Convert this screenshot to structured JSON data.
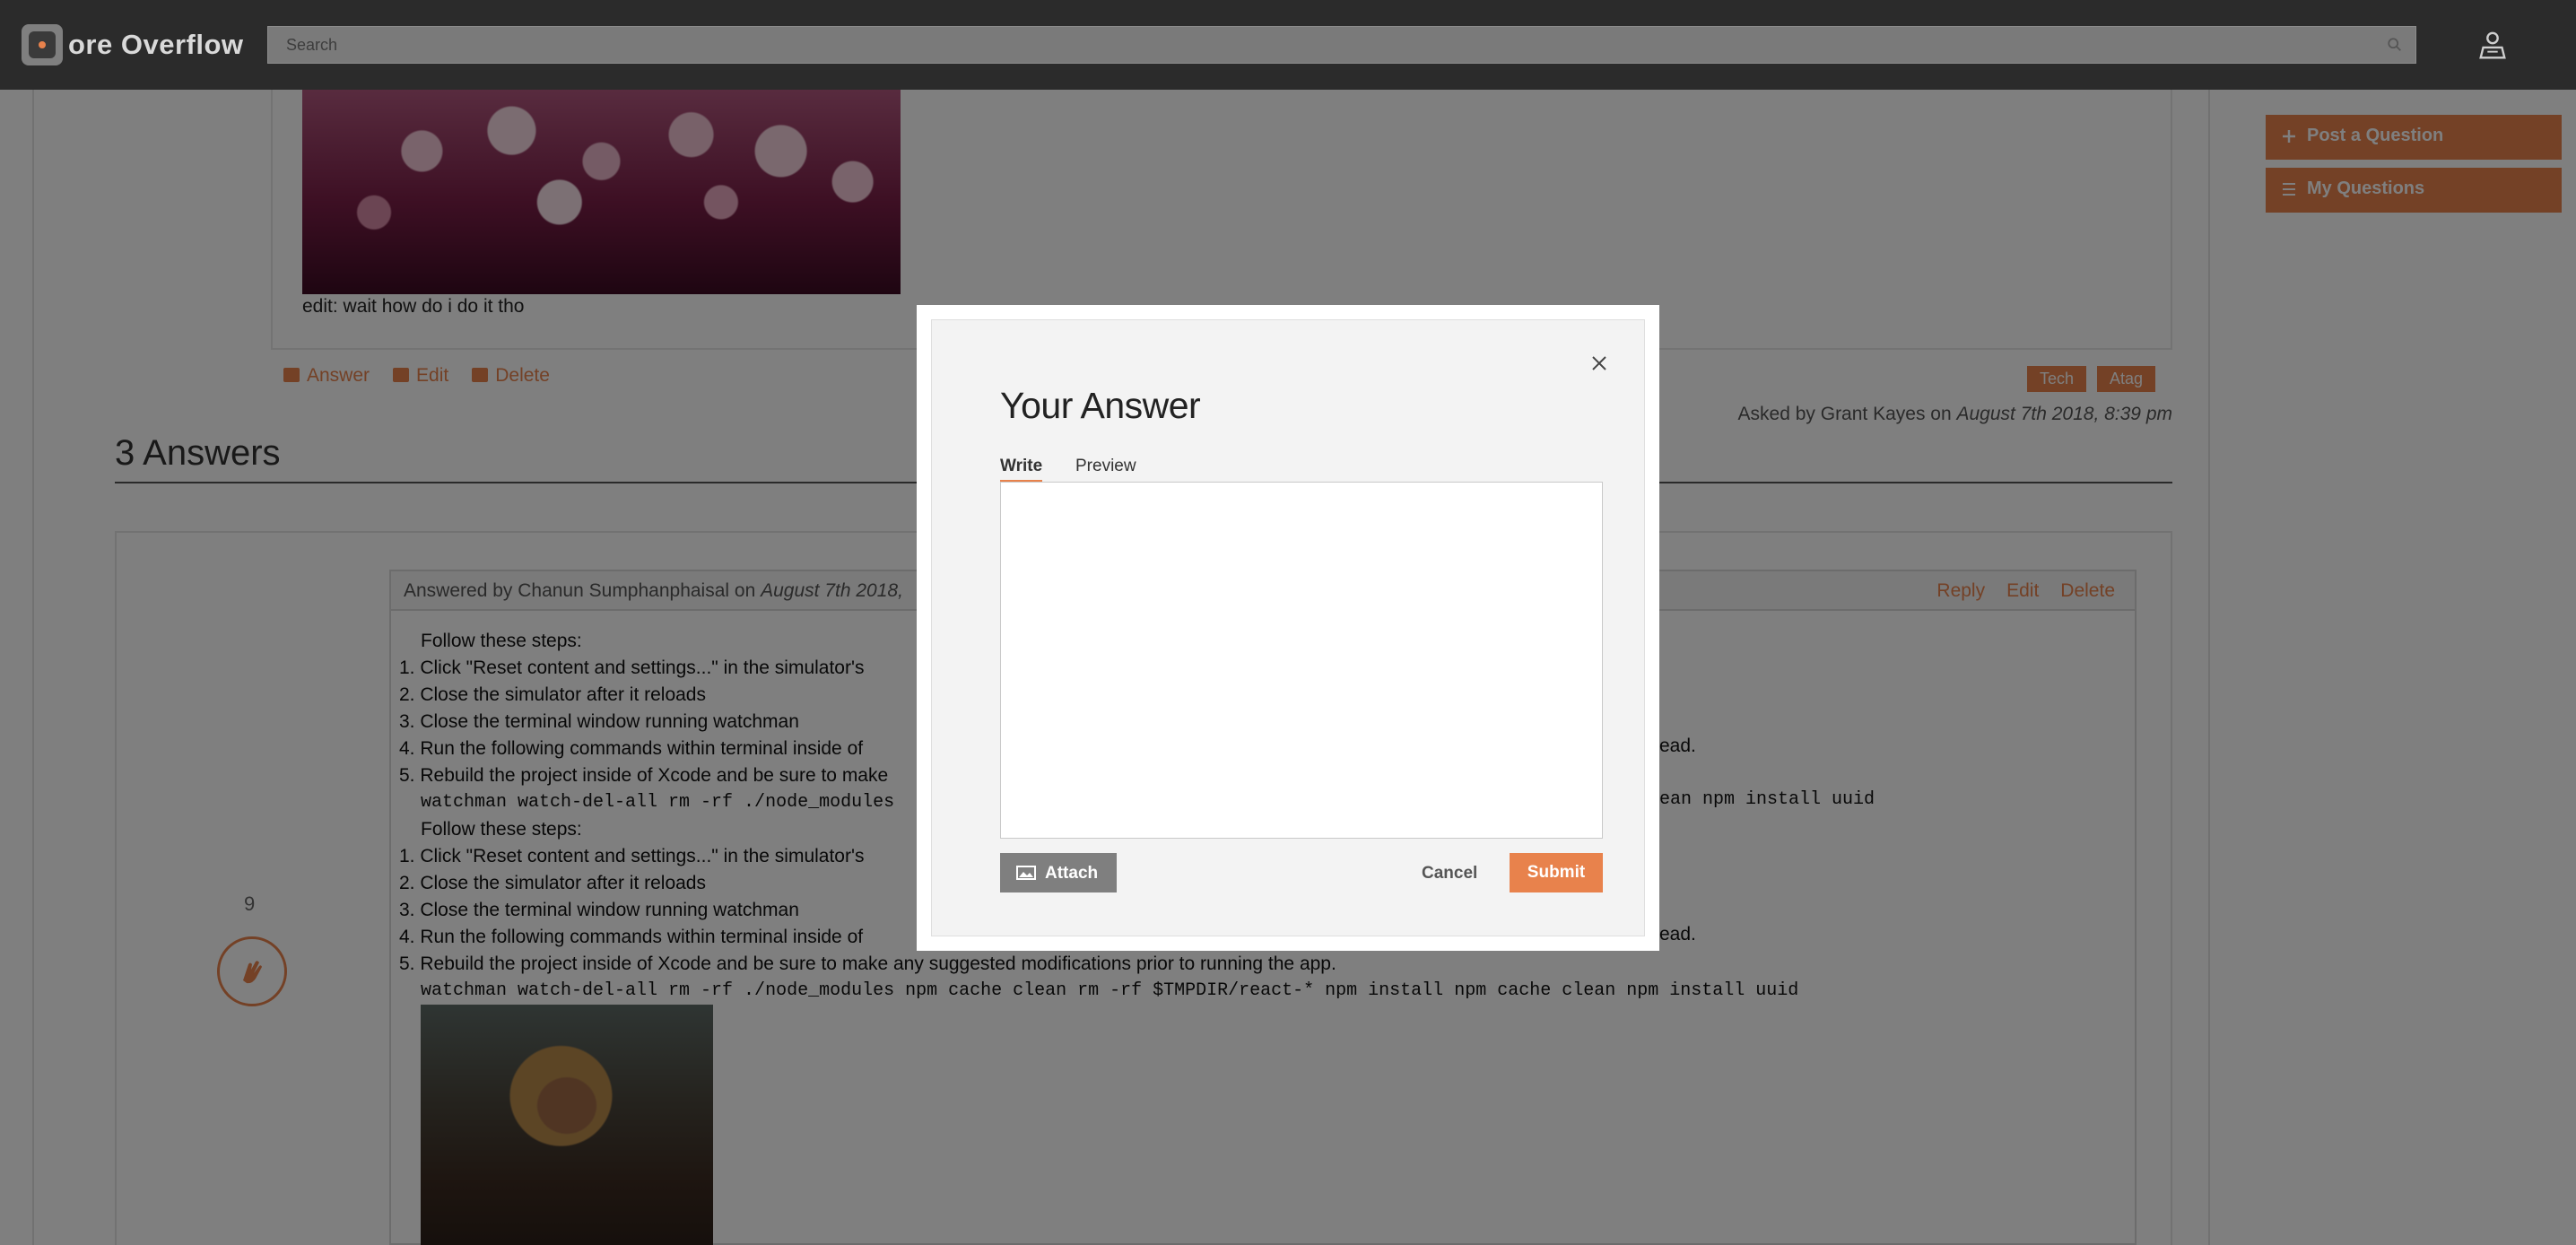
{
  "app": {
    "name": "ore Overflow"
  },
  "search": {
    "placeholder": "Search"
  },
  "question": {
    "edit_text": "edit: wait how do i do it tho",
    "actions": {
      "answer": "Answer",
      "edit": "Edit",
      "delete": "Delete"
    },
    "tags": [
      "Tech",
      "Atag"
    ],
    "asked_prefix": "Asked by Grant Kayes on ",
    "asked_date": "August 7th 2018, 8:39 pm"
  },
  "answers": {
    "title": "3 Answers",
    "first": {
      "by_prefix": "Answered by Chanun Sumphanphaisal on ",
      "date": "August 7th 2018,",
      "actions": {
        "reply": "Reply",
        "edit": "Edit",
        "delete": "Delete"
      },
      "votes": "9",
      "lines": [
        "Follow these steps:",
        "1. Click \"Reset content and settings...\" in the simulator's",
        "2. Close the simulator after it reloads",
        "3. Close the terminal window running watchman",
        "4. Run the following commands within terminal inside of",
        "5. Rebuild the project inside of Xcode and be sure to make",
        "watchman watch-del-all rm -rf ./node_modules",
        "Follow these steps:",
        "1. Click \"Reset content and settings...\" in the simulator's",
        "2. Close the simulator after it reloads",
        "3. Close the terminal window running watchman",
        "4. Run the following commands within terminal inside of",
        "5. Rebuild the project inside of Xcode and be sure to make any suggested modifications prior to running the app.",
        "watchman watch-del-all rm -rf ./node_modules npm cache clean rm -rf $TMPDIR/react-* npm install npm cache clean npm install uuid"
      ],
      "right_fragments": {
        "line4": "ead.",
        "line6": "ean npm install uuid",
        "line11": "ead."
      }
    }
  },
  "sidebar": {
    "post_question": "Post a Question",
    "my_questions": "My Questions"
  },
  "modal": {
    "title": "Your Answer",
    "tabs": {
      "write": "Write",
      "preview": "Preview"
    },
    "editor_value": "",
    "attach": "Attach",
    "cancel": "Cancel",
    "submit": "Submit"
  },
  "colors": {
    "accent": "#e8824c",
    "topbar": "#2b2b2b",
    "overlay": "rgba(0,0,0,0.5)"
  }
}
